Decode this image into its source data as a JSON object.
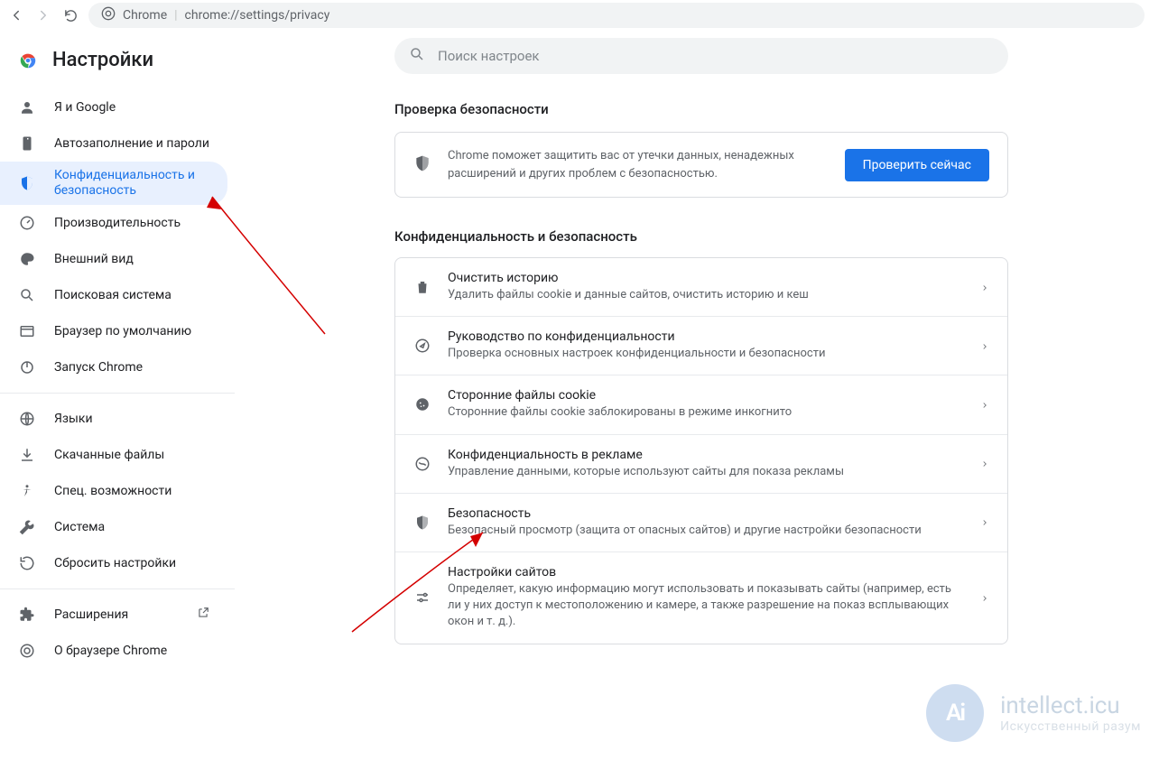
{
  "browser": {
    "chrome_label": "Chrome",
    "url": "chrome://settings/privacy"
  },
  "sidebar": {
    "title": "Настройки",
    "items": [
      {
        "label": "Я и Google"
      },
      {
        "label": "Автозаполнение и пароли"
      },
      {
        "label": "Конфиденциальность и безопасность"
      },
      {
        "label": "Производительность"
      },
      {
        "label": "Внешний вид"
      },
      {
        "label": "Поисковая система"
      },
      {
        "label": "Браузер по умолчанию"
      },
      {
        "label": "Запуск Chrome"
      }
    ],
    "items2": [
      {
        "label": "Языки"
      },
      {
        "label": "Скачанные файлы"
      },
      {
        "label": "Спец. возможности"
      },
      {
        "label": "Система"
      },
      {
        "label": "Сбросить настройки"
      }
    ],
    "items3": [
      {
        "label": "Расширения"
      },
      {
        "label": "О браузере Chrome"
      }
    ]
  },
  "search": {
    "placeholder": "Поиск настроек"
  },
  "safety": {
    "heading": "Проверка безопасности",
    "desc": "Chrome поможет защитить вас от утечки данных, ненадежных расширений и других проблем с безопасностью.",
    "button": "Проверить сейчас"
  },
  "privacy": {
    "heading": "Конфиденциальность и безопасность",
    "rows": [
      {
        "title": "Очистить историю",
        "sub": "Удалить файлы cookie и данные сайтов, очистить историю и кеш"
      },
      {
        "title": "Руководство по конфиденциальности",
        "sub": "Проверка основных настроек конфиденциальности и безопасности"
      },
      {
        "title": "Сторонние файлы cookie",
        "sub": "Сторонние файлы cookie заблокированы в режиме инкогнито"
      },
      {
        "title": "Конфиденциальность в рекламе",
        "sub": "Управление данными, которые используют сайты для показа рекламы"
      },
      {
        "title": "Безопасность",
        "sub": "Безопасный просмотр (защита от опасных сайтов) и другие настройки безопасности"
      },
      {
        "title": "Настройки сайтов",
        "sub": "Определяет, какую информацию могут использовать и показывать сайты (например, есть ли у них доступ к местоположению и камере, а также разрешение на показ всплывающих окон и т. д.)."
      }
    ]
  },
  "watermark": {
    "title": "intellect.icu",
    "sub": "Искусственный разум"
  }
}
